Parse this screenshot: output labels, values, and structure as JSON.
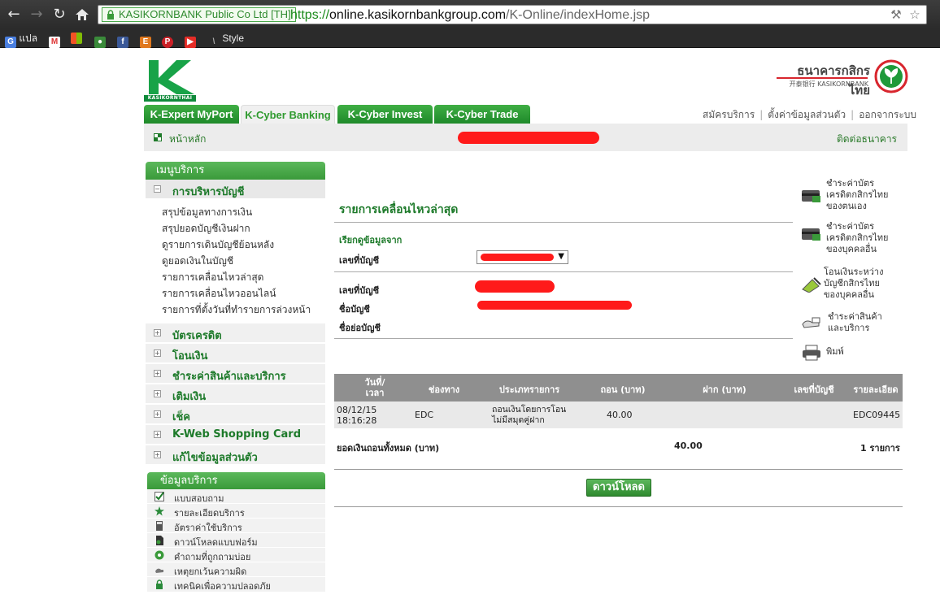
{
  "browser": {
    "ev_label": "KASIKORNBANK Public Co Ltd [TH]",
    "url_scheme": "https://",
    "url_host": "online.kasikornbankgroup.com",
    "url_path": "/K-Online/indexHome.jsp",
    "bookmarks": [
      {
        "label": "แปล",
        "icon": "translate-icon"
      },
      {
        "label": "",
        "icon": "gmail-icon"
      },
      {
        "label": "",
        "icon": "windows-icon"
      },
      {
        "label": "",
        "icon": "bookmark-icon"
      },
      {
        "label": "",
        "icon": "facebook-icon"
      },
      {
        "label": "",
        "icon": "e-icon"
      },
      {
        "label": "",
        "icon": "pinterest-icon"
      },
      {
        "label": "",
        "icon": "youtube-icon"
      },
      {
        "label": "Style",
        "icon": "style-icon"
      }
    ]
  },
  "header": {
    "logo_caption": "KASIKORNTHAI",
    "bank_name_th": "ธนาคารกสิกรไทย",
    "bank_name_en": "开泰银行 KASIKORNBANK"
  },
  "tabs": [
    {
      "label": "K-Expert MyPort",
      "active": false
    },
    {
      "label": "K-Cyber Banking",
      "active": true
    },
    {
      "label": "K-Cyber Invest",
      "active": false
    },
    {
      "label": "K-Cyber Trade",
      "active": false
    }
  ],
  "top_links": [
    "สมัครบริการ",
    "ตั้งค่าข้อมูลส่วนตัว",
    "ออกจากระบบ"
  ],
  "subbar": {
    "home": "หน้าหลัก",
    "contact": "ติดต่อธนาคาร"
  },
  "menu": {
    "title": "เมนูบริการ",
    "expanded_section": "การบริหารบัญชี",
    "sub_items": [
      "สรุปข้อมูลทางการเงิน",
      "สรุปยอดบัญชีเงินฝาก",
      "ดูรายการเดินบัญชีย้อนหลัง",
      "ดูยอดเงินในบัญชี",
      "รายการเคลื่อนไหวล่าสุด",
      "รายการเคลื่อนไหวออนไลน์",
      "รายการที่ตั้งวันที่ทำรายการล่วงหน้า"
    ],
    "sections": [
      "บัตรเครดิต",
      "โอนเงิน",
      "ชำระค่าสินค้าและบริการ",
      "เติมเงิน",
      "เช็ค",
      "K-Web Shopping Card",
      "แก้ไขข้อมูลส่วนตัว"
    ]
  },
  "info": {
    "title": "ข้อมูลบริการ",
    "items": [
      {
        "label": "แบบสอบถาม",
        "icon": "checkmark-icon"
      },
      {
        "label": "รายละเอียดบริการ",
        "icon": "star-icon"
      },
      {
        "label": "อัตราค่าใช้บริการ",
        "icon": "calculator-icon"
      },
      {
        "label": "ดาวน์โหลดแบบฟอร์ม",
        "icon": "download-icon"
      },
      {
        "label": "คำถามที่ถูกถามบ่อย",
        "icon": "faq-icon"
      },
      {
        "label": "เหตุยกเว้นความผิด",
        "icon": "hand-icon"
      },
      {
        "label": "เทคนิคเพื่อความปลอดภัย",
        "icon": "lock-icon"
      }
    ]
  },
  "main": {
    "title": "รายการเคลื่อนไหวล่าสุด",
    "query_label": "เรียกดูข้อมูลจาก",
    "account_no_label": "เลขที่บัญชี",
    "account_no_label2": "เลขที่บัญชี",
    "account_name_label": "ชื่อบัญชี",
    "account_short_label": "ชื่อย่อบัญชี",
    "table": {
      "headers": [
        "วันที่/\nเวลา",
        "ช่องทาง",
        "ประเภทรายการ",
        "ถอน (บาท)",
        "ฝาก (บาท)",
        "เลขที่บัญชี",
        "รายละเอียด"
      ],
      "row": {
        "datetime": "08/12/15\n18:16:28",
        "channel": "EDC",
        "type": "ถอนเงินโดยการโอน\nไม่มีสมุดคู่ฝาก",
        "withdraw": "40.00",
        "deposit": "",
        "account": "",
        "detail": "EDC09445"
      },
      "total_label": "ยอดเงินถอนทั้งหมด (บาท)",
      "total_value": "40.00",
      "total_count": "1 รายการ"
    },
    "download_button": "ดาวน์โหลด"
  },
  "quick_links": [
    {
      "label": "ชำระค่าบัตร\nเครดิตกสิกรไทย\nของตนเอง",
      "icon": "credit-card-icon"
    },
    {
      "label": "ชำระค่าบัตร\nเครดิตกสิกรไทย\nของบุคคลอื่น",
      "icon": "credit-card-other-icon"
    },
    {
      "label": "โอนเงินระหว่าง\nบัญชีกสิกรไทย\nของบุคคลอื่น",
      "icon": "transfer-icon"
    },
    {
      "label": "ชำระค่าสินค้า\nและบริการ",
      "icon": "payment-hand-icon"
    },
    {
      "label": "พิมพ์",
      "icon": "printer-icon"
    }
  ],
  "colors": {
    "brand_green": "#1d7a2a",
    "tab_green": "#2f9a2f",
    "redaction": "#ff1a1a"
  }
}
